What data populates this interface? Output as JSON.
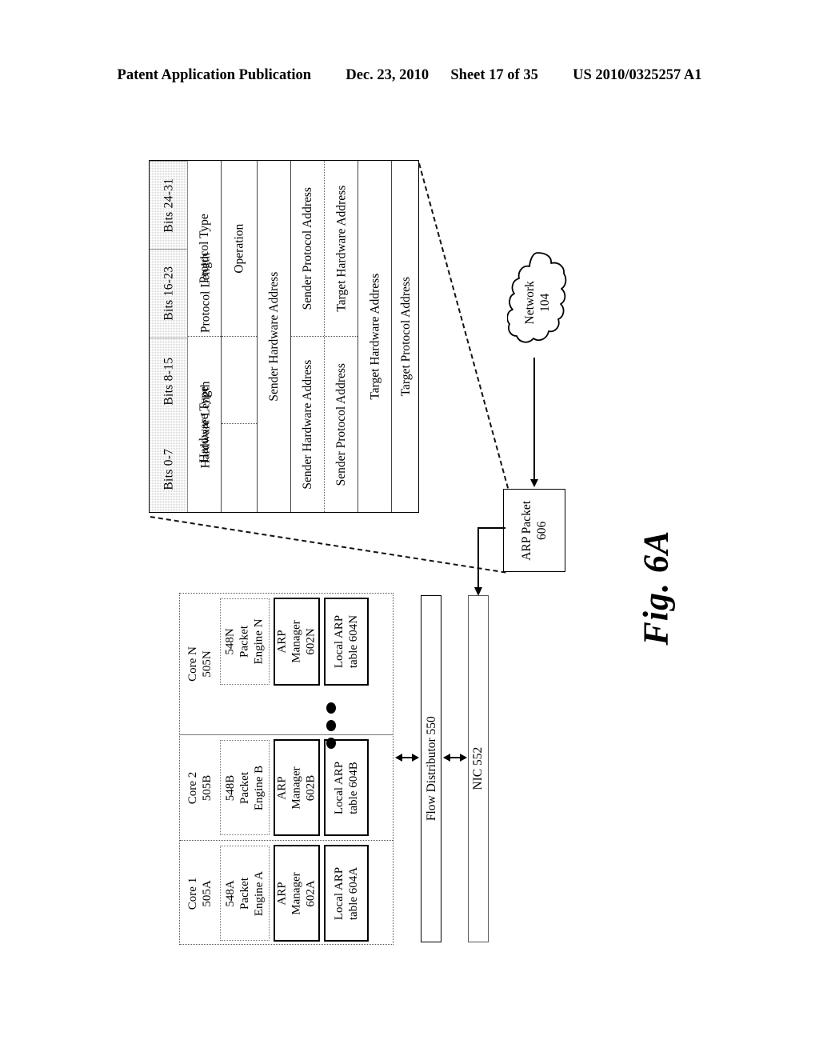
{
  "header": {
    "publication": "Patent Application Publication",
    "date": "Dec. 23, 2010",
    "sheet": "Sheet 17 of 35",
    "patent_number": "US 2010/0325257 A1"
  },
  "figure": {
    "label": "Fig. 6A"
  },
  "arp_table": {
    "bits_columns": [
      "Bits 0-7",
      "Bits 8-15",
      "Bits 16-23",
      "Bits 24-31"
    ],
    "rows": [
      {
        "left": "Hardware Type",
        "right": "Protocol Type"
      },
      {
        "left_a": "Hardware Length",
        "left_b": "Protocol Length",
        "right": "Operation"
      },
      {
        "full": "Sender Hardware Address"
      },
      {
        "left": "Sender Hardware Address",
        "right": "Sender Protocol Address"
      },
      {
        "left": "Sender Protocol Address",
        "right": "Target Hardware Address"
      },
      {
        "full": "Target Hardware Address"
      },
      {
        "full": "Target Protocol Address"
      }
    ]
  },
  "network": {
    "name": "Network",
    "ref": "104"
  },
  "arp_packet": {
    "name": "ARP Packet",
    "ref": "606"
  },
  "cores": [
    {
      "title": "Core 1",
      "ref": "505A",
      "packet_engine": {
        "ref": "548A",
        "line1": "Packet",
        "line2": "Engine A"
      },
      "arp_manager": {
        "line1": "ARP",
        "line2": "Manager",
        "ref": "602A"
      },
      "local_arp_table": {
        "line1": "Local ARP",
        "line2": "table 604A"
      }
    },
    {
      "title": "Core 2",
      "ref": "505B",
      "packet_engine": {
        "ref": "548B",
        "line1": "Packet",
        "line2": "Engine B"
      },
      "arp_manager": {
        "line1": "ARP",
        "line2": "Manager",
        "ref": "602B"
      },
      "local_arp_table": {
        "line1": "Local ARP",
        "line2": "table 604B"
      }
    },
    {
      "title": "Core N",
      "ref": "505N",
      "packet_engine": {
        "ref": "548N",
        "line1": "Packet",
        "line2": "Engine N"
      },
      "arp_manager": {
        "line1": "ARP",
        "line2": "Manager",
        "ref": "602N"
      },
      "local_arp_table": {
        "line1": "Local ARP",
        "line2": "table 604N"
      }
    }
  ],
  "ellipsis": "•••",
  "flow_distributor": "Flow Distributor 550",
  "nic": "NIC 552",
  "colors": {
    "line": "#000000",
    "header_shade": "#d8d8d8",
    "dotted_border": "#555555"
  }
}
